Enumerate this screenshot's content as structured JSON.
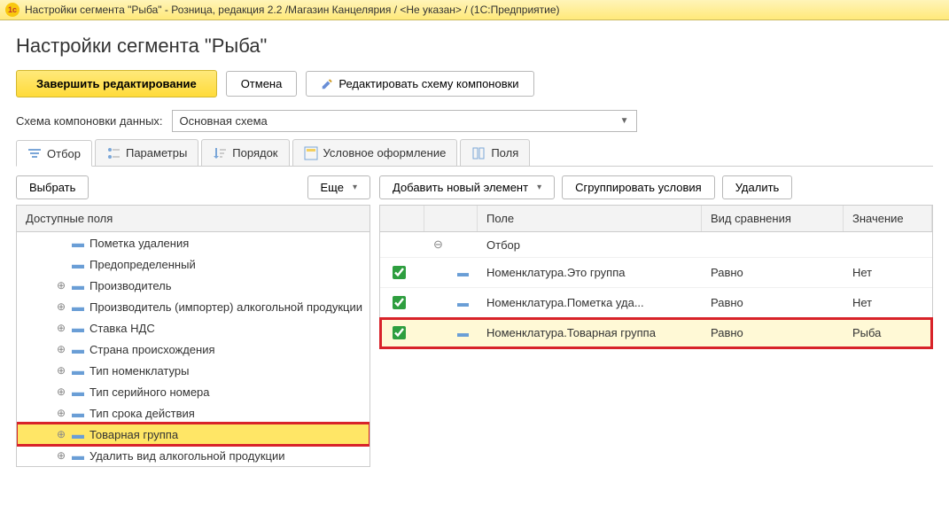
{
  "titlebar": {
    "text": "Настройки сегмента \"Рыба\" - Розница, редакция 2.2 /Магазин Канцелярия / <Не указан> /  (1С:Предприятие)"
  },
  "page": {
    "title": "Настройки сегмента \"Рыба\""
  },
  "toolbar": {
    "finish": "Завершить редактирование",
    "cancel": "Отмена",
    "edit_scheme": "Редактировать схему компоновки"
  },
  "scheme": {
    "label": "Схема компоновки данных:",
    "value": "Основная схема"
  },
  "tabs": {
    "filter": "Отбор",
    "params": "Параметры",
    "order": "Порядок",
    "cond_format": "Условное оформление",
    "fields": "Поля"
  },
  "left": {
    "choose": "Выбрать",
    "more": "Еще",
    "header": "Доступные поля",
    "items": [
      {
        "label": "Пометка удаления",
        "expand": false
      },
      {
        "label": "Предопределенный",
        "expand": false
      },
      {
        "label": "Производитель",
        "expand": true
      },
      {
        "label": "Производитель (импортер) алкогольной продукции",
        "expand": true
      },
      {
        "label": "Ставка НДС",
        "expand": true
      },
      {
        "label": "Страна происхождения",
        "expand": true
      },
      {
        "label": "Тип номенклатуры",
        "expand": true
      },
      {
        "label": "Тип серийного номера",
        "expand": true
      },
      {
        "label": "Тип срока действия",
        "expand": true
      },
      {
        "label": "Товарная группа",
        "expand": true,
        "highlight": true
      },
      {
        "label": "Удалить вид алкогольной продукции",
        "expand": true
      }
    ]
  },
  "right": {
    "add": "Добавить новый элемент",
    "group": "Сгруппировать условия",
    "delete": "Удалить",
    "cols": {
      "c3": "Поле",
      "c4": "Вид сравнения",
      "c5": "Значение"
    },
    "root": "Отбор",
    "rows": [
      {
        "checked": true,
        "field": "Номенклатура.Это группа",
        "cmp": "Равно",
        "val": "Нет"
      },
      {
        "checked": true,
        "field": "Номенклатура.Пометка уда...",
        "cmp": "Равно",
        "val": "Нет"
      },
      {
        "checked": true,
        "field": "Номенклатура.Товарная группа",
        "cmp": "Равно",
        "val": "Рыба",
        "highlight": true
      }
    ]
  }
}
